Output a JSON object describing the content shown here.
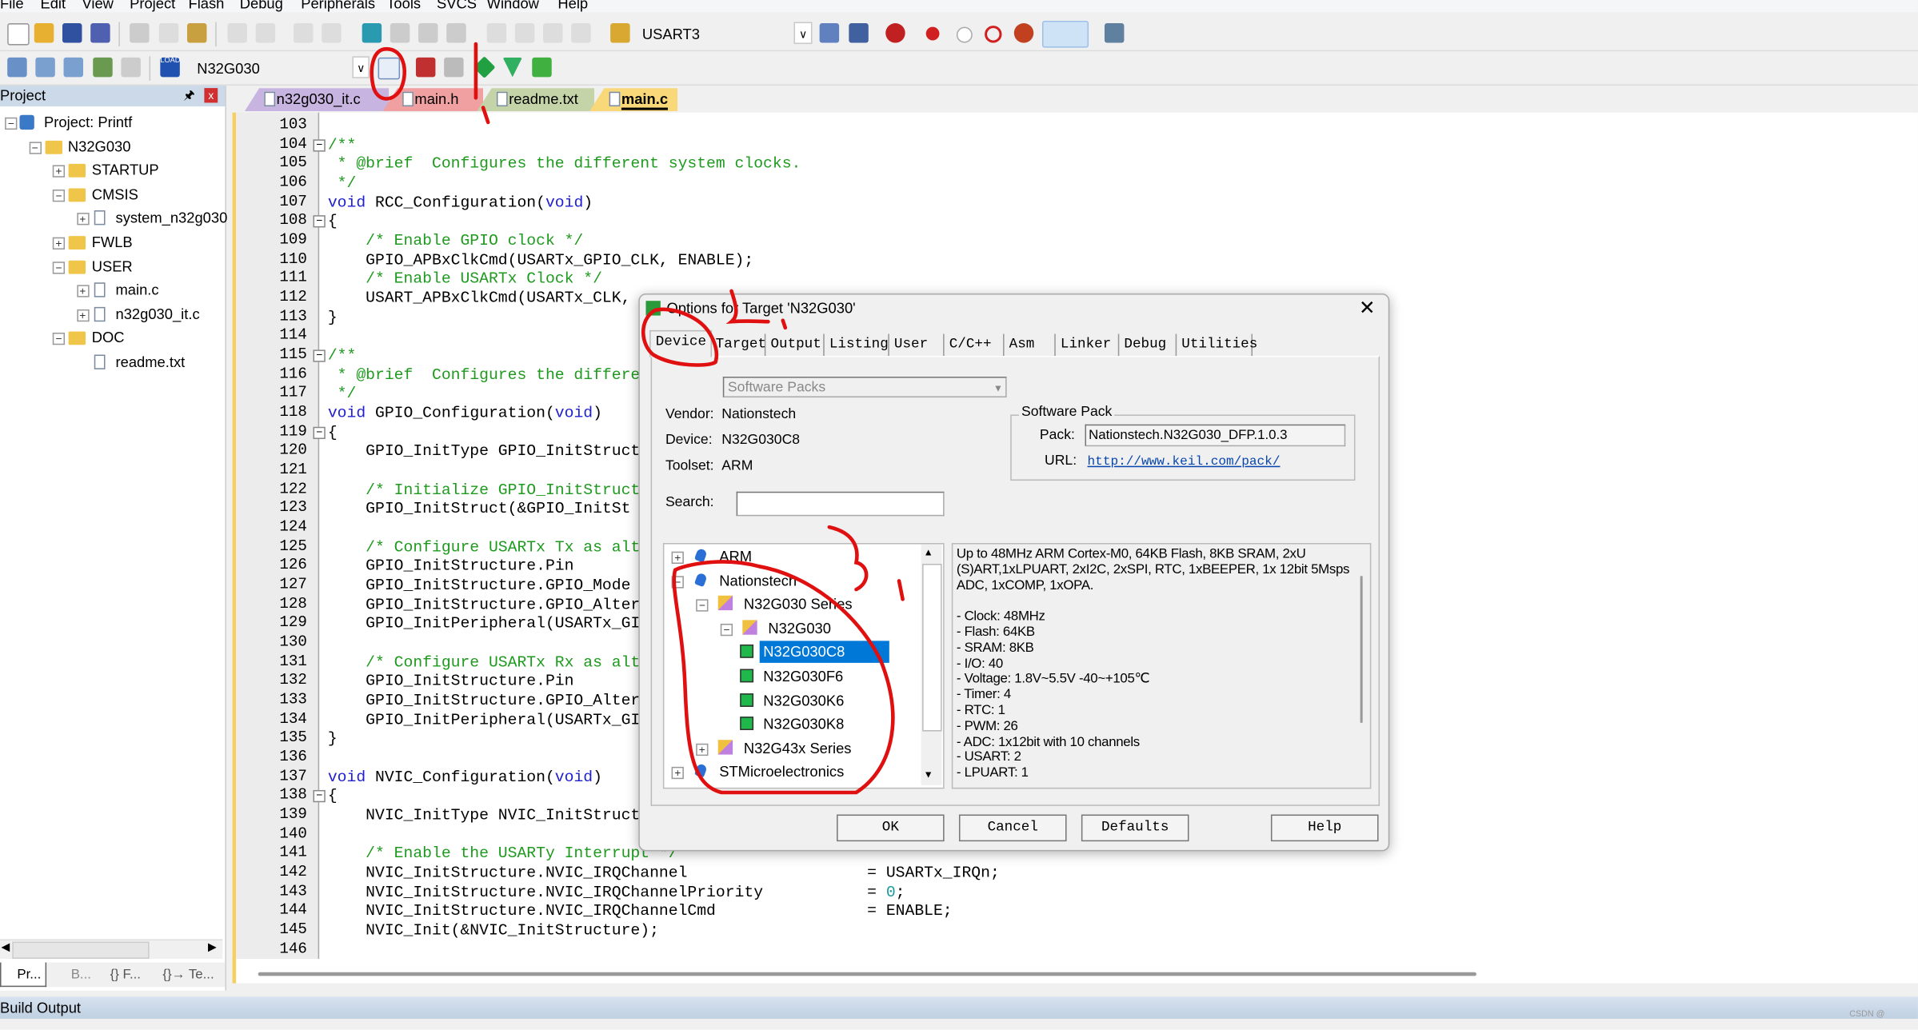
{
  "menu": [
    "File",
    "Edit",
    "View",
    "Project",
    "Flash",
    "Debug",
    "Peripherals",
    "Tools",
    "SVCS",
    "Window",
    "Help"
  ],
  "toolbar1": {
    "find_combo": "USART3"
  },
  "toolbar2": {
    "target_combo": "N32G030",
    "load_label": "LOAD"
  },
  "project": {
    "title": "Project",
    "items": [
      {
        "label": "Project: Printf",
        "level": 0,
        "expander": "minus",
        "icon": "project-icon"
      },
      {
        "label": "N32G030",
        "level": 1,
        "expander": "minus",
        "icon": "target-folder-icon"
      },
      {
        "label": "STARTUP",
        "level": 2,
        "expander": "plus",
        "icon": "folder-icon"
      },
      {
        "label": "CMSIS",
        "level": 2,
        "expander": "minus",
        "icon": "folder-icon"
      },
      {
        "label": "system_n32g030",
        "level": 3,
        "expander": "plus",
        "icon": "file-icon"
      },
      {
        "label": "FWLB",
        "level": 2,
        "expander": "plus",
        "icon": "folder-icon"
      },
      {
        "label": "USER",
        "level": 2,
        "expander": "minus",
        "icon": "folder-icon"
      },
      {
        "label": "main.c",
        "level": 3,
        "expander": "plus",
        "icon": "file-icon"
      },
      {
        "label": "n32g030_it.c",
        "level": 3,
        "expander": "plus",
        "icon": "file-icon"
      },
      {
        "label": "DOC",
        "level": 2,
        "expander": "minus",
        "icon": "folder-icon"
      },
      {
        "label": "readme.txt",
        "level": 3,
        "expander": "none",
        "icon": "file-icon"
      }
    ]
  },
  "bottom_tabs": [
    "Pr...",
    "B...",
    "{} F...",
    "{}→ Te..."
  ],
  "build_output": "Build Output",
  "editor": {
    "tabs": [
      {
        "label": "n32g030_it.c",
        "color": "#c8b4e0",
        "active": false
      },
      {
        "label": "main.h",
        "color": "#f0a0a0",
        "active": false
      },
      {
        "label": "readme.txt",
        "color": "#c4d4a8",
        "active": false
      },
      {
        "label": "main.c",
        "color": "#f8d878",
        "active": true
      }
    ],
    "first_line": 103,
    "lines": [
      "",
      "/**",
      " * @brief  Configures the different system clocks.",
      " */",
      "void RCC_Configuration(void)",
      "{",
      "    /* Enable GPIO clock */",
      "    GPIO_APBxClkCmd(USARTx_GPIO_CLK, ENABLE);",
      "    /* Enable USARTx Clock */",
      "    USART_APBxClkCmd(USARTx_CLK,",
      "}",
      "",
      "/**",
      " * @brief  Configures the differe",
      " */",
      "void GPIO_Configuration(void)",
      "{",
      "    GPIO_InitType GPIO_InitStruct",
      "",
      "    /* Initialize GPIO_InitStruct",
      "    GPIO_InitStruct(&GPIO_InitSt",
      "",
      "    /* Configure USARTx Tx as alt",
      "    GPIO_InitStructure.Pin",
      "    GPIO_InitStructure.GPIO_Mode",
      "    GPIO_InitStructure.GPIO_Alter",
      "    GPIO_InitPeripheral(USARTx_GI",
      "",
      "    /* Configure USARTx Rx as alt",
      "    GPIO_InitStructure.Pin",
      "    GPIO_InitStructure.GPIO_Alter",
      "    GPIO_InitPeripheral(USARTx_GI",
      "}",
      "",
      "void NVIC_Configuration(void)",
      "{",
      "    NVIC_InitType NVIC_InitStruct",
      "",
      "    /* Enable the USARTy Interrupt */",
      "    NVIC_InitStructure.NVIC_IRQChannel                   = USARTx_IRQn;",
      "    NVIC_InitStructure.NVIC_IRQChannelPriority           = 0;",
      "    NVIC_InitStructure.NVIC_IRQChannelCmd                = ENABLE;",
      "    NVIC_Init(&NVIC_InitStructure);",
      ""
    ],
    "fold_lines": [
      104,
      108,
      115,
      119,
      138
    ]
  },
  "dialog": {
    "title": "Options for Target 'N32G030'",
    "tabs": [
      "Device",
      "Target",
      "Output",
      "Listing",
      "User",
      "C/C++",
      "Asm",
      "Linker",
      "Debug",
      "Utilities"
    ],
    "active_tab": "Device",
    "database_select": "Software Packs",
    "vendor_label": "Vendor:",
    "vendor": "Nationstech",
    "device_label": "Device:",
    "device": "N32G030C8",
    "toolset_label": "Toolset:",
    "toolset": "ARM",
    "search_label": "Search:",
    "search_value": "",
    "pack_group": "Software Pack",
    "pack_label": "Pack:",
    "pack": "Nationstech.N32G030_DFP.1.0.3",
    "url_label": "URL:",
    "url": "http://www.keil.com/pack/",
    "tree": [
      {
        "label": "ARM",
        "level": 0,
        "expander": "plus",
        "icon": "vendor-icon"
      },
      {
        "label": "Nationstech",
        "level": 0,
        "expander": "minus",
        "icon": "vendor-icon"
      },
      {
        "label": "N32G030 Series",
        "level": 1,
        "expander": "minus",
        "icon": "series-icon"
      },
      {
        "label": "N32G030",
        "level": 2,
        "expander": "minus",
        "icon": "series-icon"
      },
      {
        "label": "N32G030C8",
        "level": 3,
        "expander": "none",
        "icon": "chip-icon",
        "selected": true
      },
      {
        "label": "N32G030F6",
        "level": 3,
        "expander": "none",
        "icon": "chip-icon"
      },
      {
        "label": "N32G030K6",
        "level": 3,
        "expander": "none",
        "icon": "chip-icon"
      },
      {
        "label": "N32G030K8",
        "level": 3,
        "expander": "none",
        "icon": "chip-icon"
      },
      {
        "label": "N32G43x Series",
        "level": 1,
        "expander": "plus",
        "icon": "series-icon"
      },
      {
        "label": "STMicroelectronics",
        "level": 0,
        "expander": "plus",
        "icon": "vendor-icon"
      }
    ],
    "description": [
      "Up to 48MHz ARM Cortex-M0, 64KB Flash, 8KB SRAM, 2xU",
      "(S)ART,1xLPUART, 2xI2C, 2xSPI, RTC, 1xBEEPER, 1x 12bit 5Msps",
      "ADC, 1xCOMP, 1xOPA.",
      "",
      "- Clock:  48MHz",
      "- Flash:  64KB",
      "- SRAM:   8KB",
      "- I/O:    40",
      "- Voltage: 1.8V~5.5V -40~+105℃",
      "- Timer:  4",
      "- RTC:    1",
      "- PWM:    26",
      "- ADC:    1x12bit with 10 channels",
      "- USART:  2",
      "- LPUART: 1"
    ],
    "buttons": {
      "ok": "OK",
      "cancel": "Cancel",
      "defaults": "Defaults",
      "help": "Help"
    }
  },
  "watermark": "CSDN @",
  "colors": {
    "selection": "#0078d7",
    "annotation": "#e01010",
    "link": "#0645ad",
    "comment": "#1e9a1e",
    "keyword": "#2020d0"
  }
}
